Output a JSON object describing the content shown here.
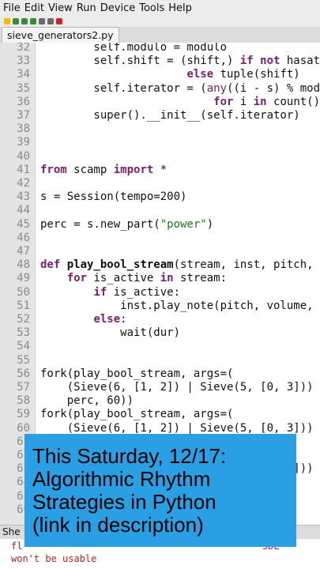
{
  "menu": [
    "File",
    "Edit",
    "View",
    "Run",
    "Device",
    "Tools",
    "Help"
  ],
  "toolbar_colors": [
    "#f0c000",
    "#3a8a3a",
    "#3a8a3a",
    "#3a8a3a",
    "#6a6a6a",
    "#6a6a6a",
    "#d22020"
  ],
  "tab": {
    "label": "sieve_generators2.py"
  },
  "lines": [
    {
      "n": "32",
      "segs": [
        {
          "t": "        self.modulo = modulo"
        }
      ]
    },
    {
      "n": "33",
      "segs": [
        {
          "t": "        self.shift = (shift,) "
        },
        {
          "t": "if not",
          "c": "kw"
        },
        {
          "t": " hasat"
        }
      ]
    },
    {
      "n": "34",
      "segs": [
        {
          "t": "                      "
        },
        {
          "t": "else",
          "c": "kw"
        },
        {
          "t": " tuple(shift)"
        }
      ]
    },
    {
      "n": "35",
      "segs": [
        {
          "t": "        self.iterator = ("
        },
        {
          "t": "any",
          "c": "kw2"
        },
        {
          "t": "((i - s) % mod"
        }
      ]
    },
    {
      "n": "36",
      "segs": [
        {
          "t": "                          "
        },
        {
          "t": "for",
          "c": "kw"
        },
        {
          "t": " i "
        },
        {
          "t": "in",
          "c": "kw"
        },
        {
          "t": " count())"
        }
      ]
    },
    {
      "n": "37",
      "segs": [
        {
          "t": "        super().__init__(self.iterator)"
        }
      ]
    },
    {
      "n": "38",
      "segs": [
        {
          "t": ""
        }
      ]
    },
    {
      "n": "39",
      "segs": [
        {
          "t": ""
        }
      ]
    },
    {
      "n": "40",
      "segs": [
        {
          "t": ""
        }
      ]
    },
    {
      "n": "41",
      "segs": [
        {
          "t": "from",
          "c": "kw"
        },
        {
          "t": " scamp "
        },
        {
          "t": "import",
          "c": "kw"
        },
        {
          "t": " *"
        }
      ]
    },
    {
      "n": "42",
      "segs": [
        {
          "t": ""
        }
      ]
    },
    {
      "n": "43",
      "segs": [
        {
          "t": "s = Session(tempo=200)"
        }
      ]
    },
    {
      "n": "44",
      "segs": [
        {
          "t": ""
        }
      ]
    },
    {
      "n": "45",
      "segs": [
        {
          "t": "perc = s.new_part("
        },
        {
          "t": "\"power\"",
          "c": "str"
        },
        {
          "t": ")"
        }
      ]
    },
    {
      "n": "46",
      "segs": [
        {
          "t": ""
        }
      ]
    },
    {
      "n": "47",
      "segs": [
        {
          "t": ""
        }
      ]
    },
    {
      "n": "48",
      "segs": [
        {
          "t": "def",
          "c": "kw"
        },
        {
          "t": " "
        },
        {
          "t": "play_bool_stream",
          "c": "fn"
        },
        {
          "t": "(stream, inst, pitch,"
        }
      ]
    },
    {
      "n": "49",
      "segs": [
        {
          "t": "    "
        },
        {
          "t": "for",
          "c": "kw"
        },
        {
          "t": " is_active "
        },
        {
          "t": "in",
          "c": "kw"
        },
        {
          "t": " stream:"
        }
      ]
    },
    {
      "n": "50",
      "segs": [
        {
          "t": "        "
        },
        {
          "t": "if",
          "c": "kw"
        },
        {
          "t": " is_active:"
        }
      ]
    },
    {
      "n": "51",
      "segs": [
        {
          "t": "            inst.play_note(pitch, volume,"
        }
      ]
    },
    {
      "n": "52",
      "segs": [
        {
          "t": "        "
        },
        {
          "t": "else",
          "c": "kw"
        },
        {
          "t": ":"
        }
      ]
    },
    {
      "n": "53",
      "segs": [
        {
          "t": "            wait(dur)"
        }
      ]
    },
    {
      "n": "54",
      "segs": [
        {
          "t": ""
        }
      ]
    },
    {
      "n": "55",
      "segs": [
        {
          "t": ""
        }
      ]
    },
    {
      "n": "56",
      "segs": [
        {
          "t": "fork(play_bool_stream, args=("
        }
      ]
    },
    {
      "n": "57",
      "segs": [
        {
          "t": "    (Sieve(6, [1, 2]) | Sieve(5, [0, 3]))"
        }
      ]
    },
    {
      "n": "58",
      "segs": [
        {
          "t": "    perc, 60))"
        }
      ]
    },
    {
      "n": "59",
      "segs": [
        {
          "t": "fork(play_bool_stream, args=("
        }
      ]
    },
    {
      "n": "60",
      "segs": [
        {
          "t": "    (Sieve(6, [1, 2]) | Sieve(5, [0, 3]))"
        }
      ]
    },
    {
      "n": "61",
      "segs": [
        {
          "t": ""
        }
      ]
    },
    {
      "n": "62",
      "segs": [
        {
          "t": ""
        }
      ]
    },
    {
      "n": "63",
      "segs": [
        {
          "t": "                                     3]))"
        }
      ]
    },
    {
      "n": "64",
      "segs": [
        {
          "t": ""
        }
      ]
    },
    {
      "n": "65",
      "segs": [
        {
          "t": ""
        }
      ]
    },
    {
      "n": "66",
      "segs": [
        {
          "t": ""
        }
      ]
    }
  ],
  "shell": {
    "tab_label": "She",
    "lines": [
      "fl                                          SDL",
      "won't be usable"
    ]
  },
  "overlay": {
    "lines": [
      "This Saturday, 12/17:",
      "Algorithmic Rhythm",
      "Strategies in Python",
      " (link in description)"
    ]
  },
  "colors": {
    "keyword": "#7a1d72",
    "string": "#1a7a1a",
    "overlay_bg": "#2a9fe3"
  }
}
